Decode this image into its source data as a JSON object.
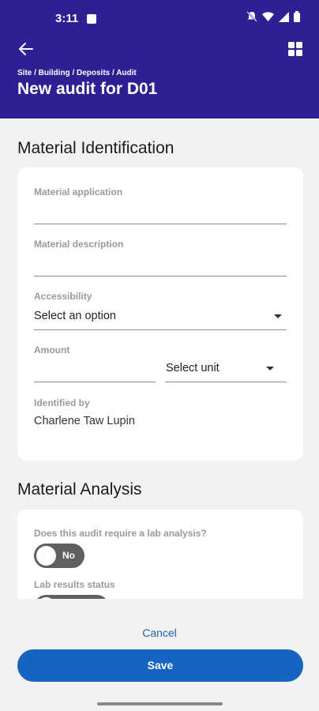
{
  "status_bar": {
    "time": "3:11"
  },
  "header": {
    "breadcrumb": "Site / Building / Deposits / Audit",
    "title": "New audit for D01",
    "back_icon": "arrow-left-icon",
    "menu_icon": "grid-icon"
  },
  "identification": {
    "section_title": "Material Identification",
    "application_label": "Material application",
    "application_value": "",
    "description_label": "Material description",
    "description_value": "",
    "accessibility_label": "Accessibility",
    "accessibility_value": "Select an option",
    "amount_label": "Amount",
    "amount_value": "",
    "unit_value": "Select unit",
    "identified_by_label": "Identified by",
    "identified_by_value": "Charlene Taw Lupin"
  },
  "analysis": {
    "section_title": "Material Analysis",
    "lab_question": "Does this audit require a lab analysis?",
    "lab_toggle_label": "No",
    "lab_status_label": "Lab results status"
  },
  "footer": {
    "cancel_label": "Cancel",
    "save_label": "Save"
  },
  "colors": {
    "header_bg": "#2e1f95",
    "primary": "#1565c0",
    "toggle_off": "#606060"
  }
}
